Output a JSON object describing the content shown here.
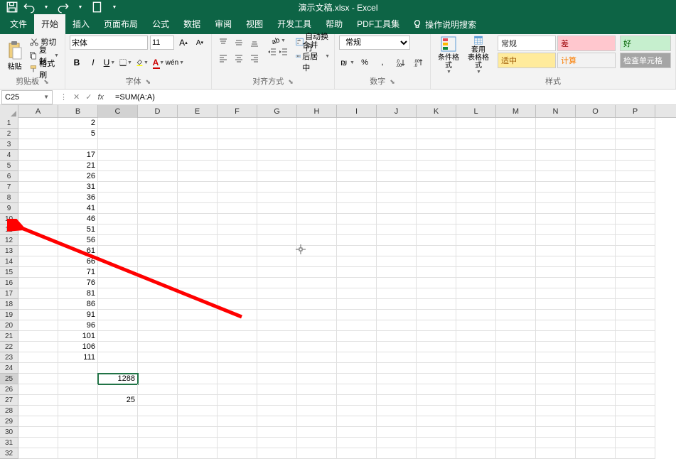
{
  "title": "演示文稿.xlsx - Excel",
  "menu": {
    "file": "文件",
    "home": "开始",
    "insert": "插入",
    "layout": "页面布局",
    "formulas": "公式",
    "data": "数据",
    "review": "审阅",
    "view": "视图",
    "developer": "开发工具",
    "help": "帮助",
    "pdf": "PDF工具集"
  },
  "tell_me": "操作说明搜索",
  "ribbon": {
    "clipboard": {
      "label": "剪贴板",
      "paste": "粘贴",
      "cut": "剪切",
      "copy": "复制",
      "painter": "格式刷"
    },
    "font": {
      "label": "字体",
      "name": "宋体",
      "size": "11"
    },
    "alignment": {
      "label": "对齐方式",
      "wrap": "自动换行",
      "merge": "合并后居中"
    },
    "number": {
      "label": "数字",
      "format": "常规",
      "pct": "%",
      "comma": ","
    },
    "styles": {
      "label": "样式",
      "cond": "条件格式",
      "table": "套用\n表格格式",
      "normal": "常规",
      "bad": "差",
      "good": "好",
      "neutral": "适中",
      "calc": "计算",
      "check": "检查单元格"
    }
  },
  "name_box": "C25",
  "formula": "=SUM(A:A)",
  "columns": [
    "A",
    "B",
    "C",
    "D",
    "E",
    "F",
    "G",
    "H",
    "I",
    "J",
    "K",
    "L",
    "M",
    "N",
    "O",
    "P"
  ],
  "rows": [
    1,
    2,
    3,
    4,
    5,
    6,
    7,
    8,
    9,
    10,
    11,
    12,
    13,
    14,
    15,
    16,
    17,
    18,
    19,
    20,
    21,
    22,
    23,
    24,
    25,
    26,
    27,
    28,
    29,
    30,
    31,
    32
  ],
  "selected_row": 25,
  "selected_col_idx": 2,
  "data": {
    "B1": "2",
    "B2": "5",
    "B4": "17",
    "B5": "21",
    "B6": "26",
    "B7": "31",
    "B8": "36",
    "B9": "41",
    "B10": "46",
    "B11": "51",
    "B12": "56",
    "B13": "61",
    "B14": "66",
    "B15": "71",
    "B16": "76",
    "B17": "81",
    "B18": "86",
    "B19": "91",
    "B20": "96",
    "B21": "101",
    "B22": "106",
    "B23": "111",
    "C25": "1288",
    "C27": "25"
  }
}
